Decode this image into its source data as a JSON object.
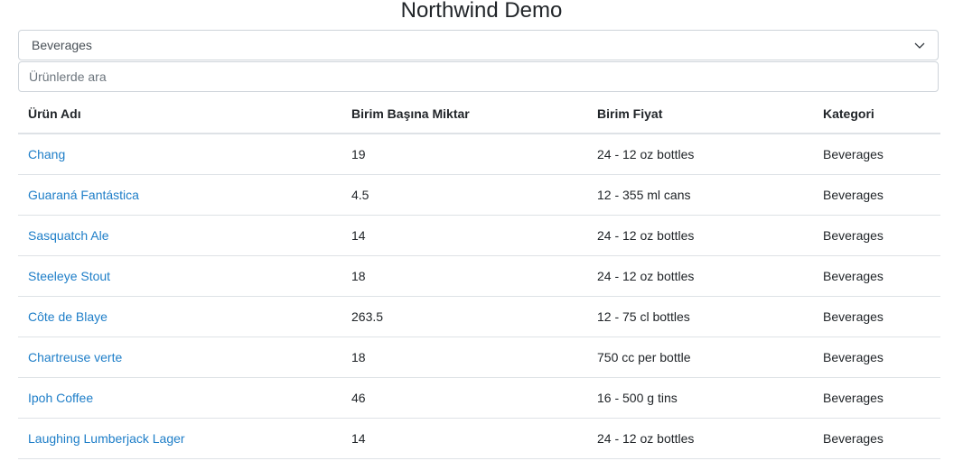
{
  "app": {
    "title": "Northwind Demo"
  },
  "category_select": {
    "selected": "Beverages"
  },
  "search": {
    "placeholder": "Ürünlerde ara"
  },
  "table": {
    "headers": [
      "Ürün Adı",
      "Birim Başına Miktar",
      "Birim Fiyat",
      "Kategori"
    ],
    "rows": [
      {
        "name": "Chang",
        "quantity": "19",
        "price": "24 - 12 oz bottles",
        "category": "Beverages"
      },
      {
        "name": "Guaraná Fantástica",
        "quantity": "4.5",
        "price": "12 - 355 ml cans",
        "category": "Beverages"
      },
      {
        "name": "Sasquatch Ale",
        "quantity": "14",
        "price": "24 - 12 oz bottles",
        "category": "Beverages"
      },
      {
        "name": "Steeleye Stout",
        "quantity": "18",
        "price": "24 - 12 oz bottles",
        "category": "Beverages"
      },
      {
        "name": "Côte de Blaye",
        "quantity": "263.5",
        "price": "12 - 75 cl bottles",
        "category": "Beverages"
      },
      {
        "name": "Chartreuse verte",
        "quantity": "18",
        "price": "750 cc per bottle",
        "category": "Beverages"
      },
      {
        "name": "Ipoh Coffee",
        "quantity": "46",
        "price": "16 - 500 g tins",
        "category": "Beverages"
      },
      {
        "name": "Laughing Lumberjack Lager",
        "quantity": "14",
        "price": "24 - 12 oz bottles",
        "category": "Beverages"
      }
    ]
  },
  "colors": {
    "link": "#1e7ec8",
    "border": "#dee2e6"
  }
}
